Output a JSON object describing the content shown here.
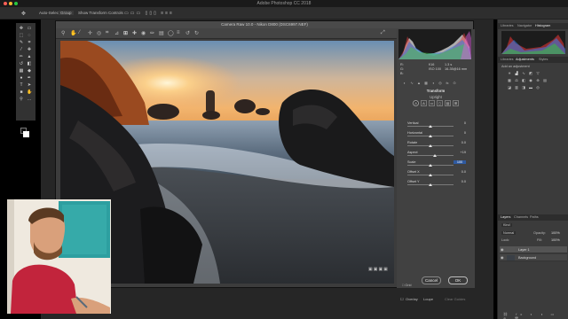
{
  "app": {
    "title": "Adobe Photoshop CC 2018",
    "traffic_colors": [
      "#ff5f57",
      "#febc2e",
      "#28c840"
    ]
  },
  "options_bar": {
    "auto_select_label": "Auto-Select:",
    "auto_select_value": "Group",
    "transform_label": "Show Transform Controls"
  },
  "camera_raw": {
    "title": "Camera Raw 10.0 - Nikon D800 (DSC6997.NEF)",
    "readout": {
      "r": "R:",
      "g": "G:",
      "b": "B:",
      "aperture": "f/16",
      "shutter": "1.3 s",
      "iso": "ISO 100",
      "lens": "16-35@16 mm"
    },
    "section_title": "Transform",
    "upright_label": "Upright",
    "upright_modes": [
      "⊘",
      "A",
      "▭",
      "▯",
      "▤",
      "⊞"
    ],
    "sliders": [
      {
        "label": "Vertical",
        "value": "0",
        "pos": 0.5
      },
      {
        "label": "Horizontal",
        "value": "0",
        "pos": 0.5
      },
      {
        "label": "Rotate",
        "value": "0.0",
        "pos": 0.5
      },
      {
        "label": "Aspect",
        "value": "+19",
        "pos": 0.6
      },
      {
        "label": "Scale",
        "value": "100",
        "pos": 0.5,
        "selected": true
      },
      {
        "label": "Offset X",
        "value": "0.0",
        "pos": 0.5
      },
      {
        "label": "Offset Y",
        "value": "0.0",
        "pos": 0.5
      }
    ],
    "grid_label": "Grid",
    "overlay_label": "Overlay",
    "loupe_label": "Loupe",
    "clear_guides_label": "Clear Guides",
    "cancel_label": "Cancel",
    "ok_label": "OK"
  },
  "right_panels": {
    "top_tabs": [
      "Libraries",
      "Navigator",
      "Histogram"
    ],
    "adjust_tabs": [
      "Libraries",
      "Adjustments",
      "Styles"
    ],
    "add_adjustment": "Add an adjustment",
    "layers_tabs": [
      "Layers",
      "Channels",
      "Paths"
    ],
    "kind_label": "Kind",
    "blend_mode": "Normal",
    "opacity_label": "Opacity:",
    "opacity_value": "100%",
    "lock_label": "Lock:",
    "fill_label": "Fill:",
    "fill_value": "100%",
    "layers": [
      "Layer 1",
      "Background"
    ]
  }
}
